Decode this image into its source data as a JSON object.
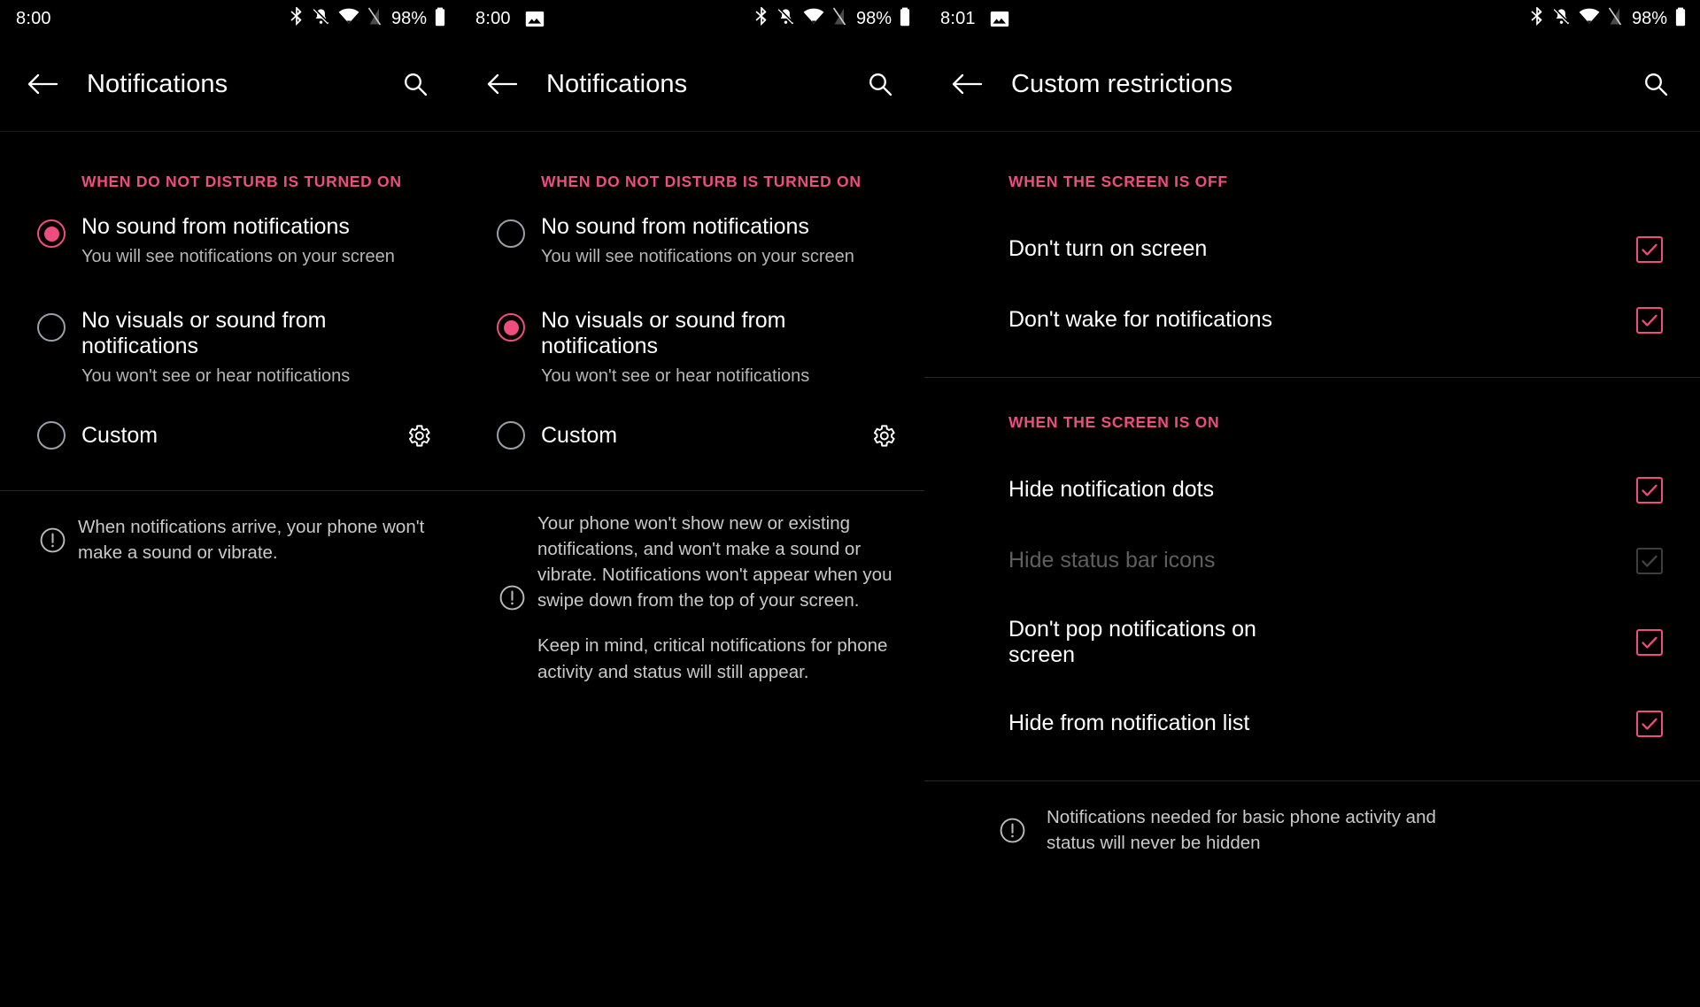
{
  "theme": {
    "accent": "#ef4c7f",
    "bg": "#000000",
    "text": "#ffffff",
    "subtext": "#b6b6b6",
    "disabled": "#5f5f5f"
  },
  "panels": [
    {
      "status_bar": {
        "time": "8:00",
        "battery_percent": "98%",
        "icons": [
          "bluetooth-icon",
          "notifications-muted-icon",
          "wifi-icon",
          "signal-off-icon",
          "battery-icon"
        ]
      },
      "appbar": {
        "back": "back-arrow-icon",
        "title": "Notifications",
        "search": "search-icon"
      },
      "section_header": "WHEN DO NOT DISTURB IS TURNED ON",
      "options": [
        {
          "title": "No sound from notifications",
          "subtitle": "You will see notifications on your screen",
          "selected": true,
          "gear": false
        },
        {
          "title": "No visuals or sound from notifications",
          "subtitle": "You won't see or hear notifications",
          "selected": false,
          "gear": false
        },
        {
          "title": "Custom",
          "subtitle": "",
          "selected": false,
          "gear": true
        }
      ],
      "info_paragraphs": [
        "When notifications arrive, your phone won't make a sound or vibrate."
      ]
    },
    {
      "status_bar": {
        "time": "8:00",
        "battery_percent": "98%",
        "icons": [
          "photo-icon",
          "bluetooth-icon",
          "notifications-muted-icon",
          "wifi-icon",
          "signal-off-icon",
          "battery-icon"
        ]
      },
      "appbar": {
        "back": "back-arrow-icon",
        "title": "Notifications",
        "search": "search-icon"
      },
      "section_header": "WHEN DO NOT DISTURB IS TURNED ON",
      "options": [
        {
          "title": "No sound from notifications",
          "subtitle": "You will see notifications on your screen",
          "selected": false,
          "gear": false
        },
        {
          "title": "No visuals or sound from notifications",
          "subtitle": "You won't see or hear notifications",
          "selected": true,
          "gear": false
        },
        {
          "title": "Custom",
          "subtitle": "",
          "selected": false,
          "gear": true
        }
      ],
      "info_paragraphs": [
        "Your phone won't show new or existing notifications, and won't make a sound or vibrate. Notifications won't appear when you swipe down from the top of your screen.",
        "Keep in mind, critical notifications for phone activity and status will still appear."
      ]
    },
    {
      "status_bar": {
        "time": "8:01",
        "battery_percent": "98%",
        "icons": [
          "photo-icon",
          "bluetooth-icon",
          "notifications-muted-icon",
          "wifi-icon",
          "signal-off-icon",
          "battery-icon"
        ]
      },
      "appbar": {
        "back": "back-arrow-icon",
        "title": "Custom restrictions",
        "search": "search-icon"
      },
      "group_screen_off": {
        "header": "WHEN THE SCREEN IS OFF",
        "items": [
          {
            "label": "Don't turn on screen",
            "checked": true,
            "enabled": true
          },
          {
            "label": "Don't wake for notifications",
            "checked": true,
            "enabled": true
          }
        ]
      },
      "group_screen_on": {
        "header": "WHEN THE SCREEN IS ON",
        "items": [
          {
            "label": "Hide notification dots",
            "checked": true,
            "enabled": true
          },
          {
            "label": "Hide status bar icons",
            "checked": true,
            "enabled": false
          },
          {
            "label": "Don't pop notifications on screen",
            "checked": true,
            "enabled": true
          },
          {
            "label": "Hide from notification list",
            "checked": true,
            "enabled": true
          }
        ]
      },
      "info_paragraphs": [
        "Notifications needed for basic phone activity and status will never be hidden"
      ]
    }
  ]
}
